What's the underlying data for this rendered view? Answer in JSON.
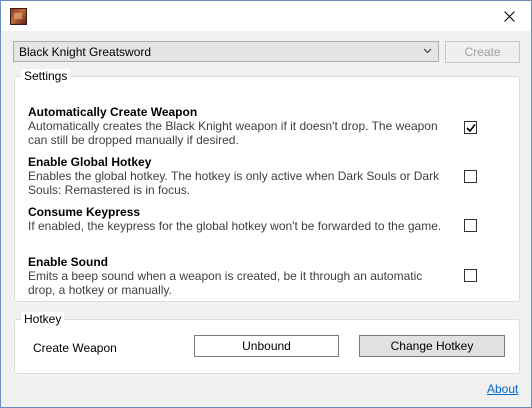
{
  "window": {
    "close_icon": "close-icon",
    "app_icon": "app-icon"
  },
  "weapon_select": {
    "value": "Black Knight Greatsword",
    "create_label": "Create"
  },
  "settings": {
    "label": "Settings",
    "options": [
      {
        "title": "Automatically Create Weapon",
        "description": "Automatically creates the Black Knight weapon if it doesn't drop. The weapon can still be dropped manually if desired.",
        "checked": true
      },
      {
        "title": "Enable Global Hotkey",
        "description": "Enables the global hotkey. The hotkey is only active when Dark Souls or Dark Souls: Remastered is in focus.",
        "checked": false
      },
      {
        "title": "Consume Keypress",
        "description": "If enabled, the keypress for the global hotkey won't be forwarded to the game.",
        "checked": false
      },
      {
        "title": "Enable Sound",
        "description": "Emits a beep sound when a weapon is created, be it through an automatic drop, a hotkey or manually.",
        "checked": false
      }
    ]
  },
  "hotkey": {
    "label": "Hotkey",
    "action_label": "Create Weapon",
    "binding": "Unbound",
    "change_label": "Change Hotkey"
  },
  "footer": {
    "about_label": "About"
  },
  "colors": {
    "link": "#0066cc",
    "border": "#dcdcdc",
    "disabled_text": "#a0a0a0"
  }
}
